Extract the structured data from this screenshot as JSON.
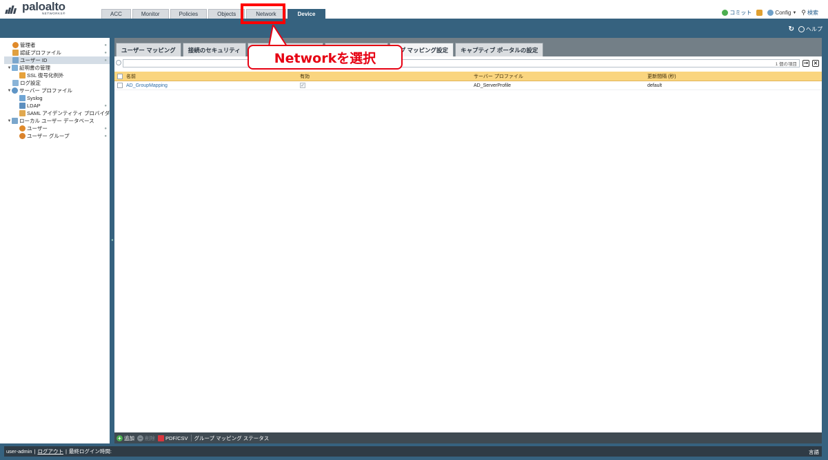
{
  "header": {
    "logo": {
      "name": "paloalto",
      "sub": "NETWORKS®"
    },
    "tabs": [
      {
        "label": "ACC",
        "active": false
      },
      {
        "label": "Monitor",
        "active": false
      },
      {
        "label": "Policies",
        "active": false
      },
      {
        "label": "Objects",
        "active": false
      },
      {
        "label": "Network",
        "active": false
      },
      {
        "label": "Device",
        "active": true
      }
    ],
    "top_right": {
      "commit": "コミット",
      "config": "Config",
      "search": "検索"
    },
    "band_right": {
      "help": "ヘルプ"
    }
  },
  "sidebar": {
    "items": [
      {
        "label": "管理者",
        "icon": "admin-icon"
      },
      {
        "label": "認証プロファイル",
        "icon": "auth-profile-icon"
      },
      {
        "label": "ユーザー ID",
        "icon": "user-id-icon",
        "selected": true
      },
      {
        "label": "証明書の管理",
        "icon": "certificate-icon",
        "expanded": true
      },
      {
        "label": "SSL 復号化例外",
        "icon": "ssl-exception-icon"
      },
      {
        "label": "ログ設定",
        "icon": "log-settings-icon"
      },
      {
        "label": "サーバー プロファイル",
        "icon": "server-profile-icon",
        "expanded": true
      },
      {
        "label": "Syslog",
        "icon": "syslog-icon"
      },
      {
        "label": "LDAP",
        "icon": "ldap-icon"
      },
      {
        "label": "SAML アイデンティティ プロバイダ",
        "icon": "saml-icon"
      },
      {
        "label": "ローカル ユーザー データベース",
        "icon": "local-db-icon",
        "expanded": true
      },
      {
        "label": "ユーザー",
        "icon": "user-icon"
      },
      {
        "label": "ユーザー グループ",
        "icon": "user-group-icon"
      }
    ]
  },
  "content": {
    "subtabs": [
      {
        "label": "ユーザー マッピング",
        "active": false
      },
      {
        "label": "接続のセキュリティ",
        "active": false
      },
      {
        "label": "",
        "active": false
      },
      {
        "label": "",
        "active": false
      },
      {
        "label": "ープ マッピング設定",
        "active": true
      },
      {
        "label": "キャプティブ ポータルの設定",
        "active": false
      }
    ],
    "filter": {
      "count_text": "1 個の項目"
    },
    "table": {
      "columns": [
        "名前",
        "有効",
        "サーバー プロファイル",
        "更新間隔 (秒)"
      ],
      "rows": [
        {
          "name": "AD_GroupMapping",
          "enabled": true,
          "server_profile": "AD_ServerProfile",
          "interval": "default"
        }
      ]
    },
    "toolbar": {
      "add": "追加",
      "delete": "削除",
      "export": "PDF/CSV",
      "status": "グループ マッピング ステータス"
    }
  },
  "status_bar": {
    "user": "user-admin",
    "logout": "ログアウト",
    "last_login": "最終ログイン時間:",
    "language": "言語"
  },
  "annotation": {
    "callout": "Networkを選択"
  },
  "colors": {
    "brand_blue": "#36627f",
    "table_header": "#fad57f",
    "annotation_red": "#e60012"
  }
}
